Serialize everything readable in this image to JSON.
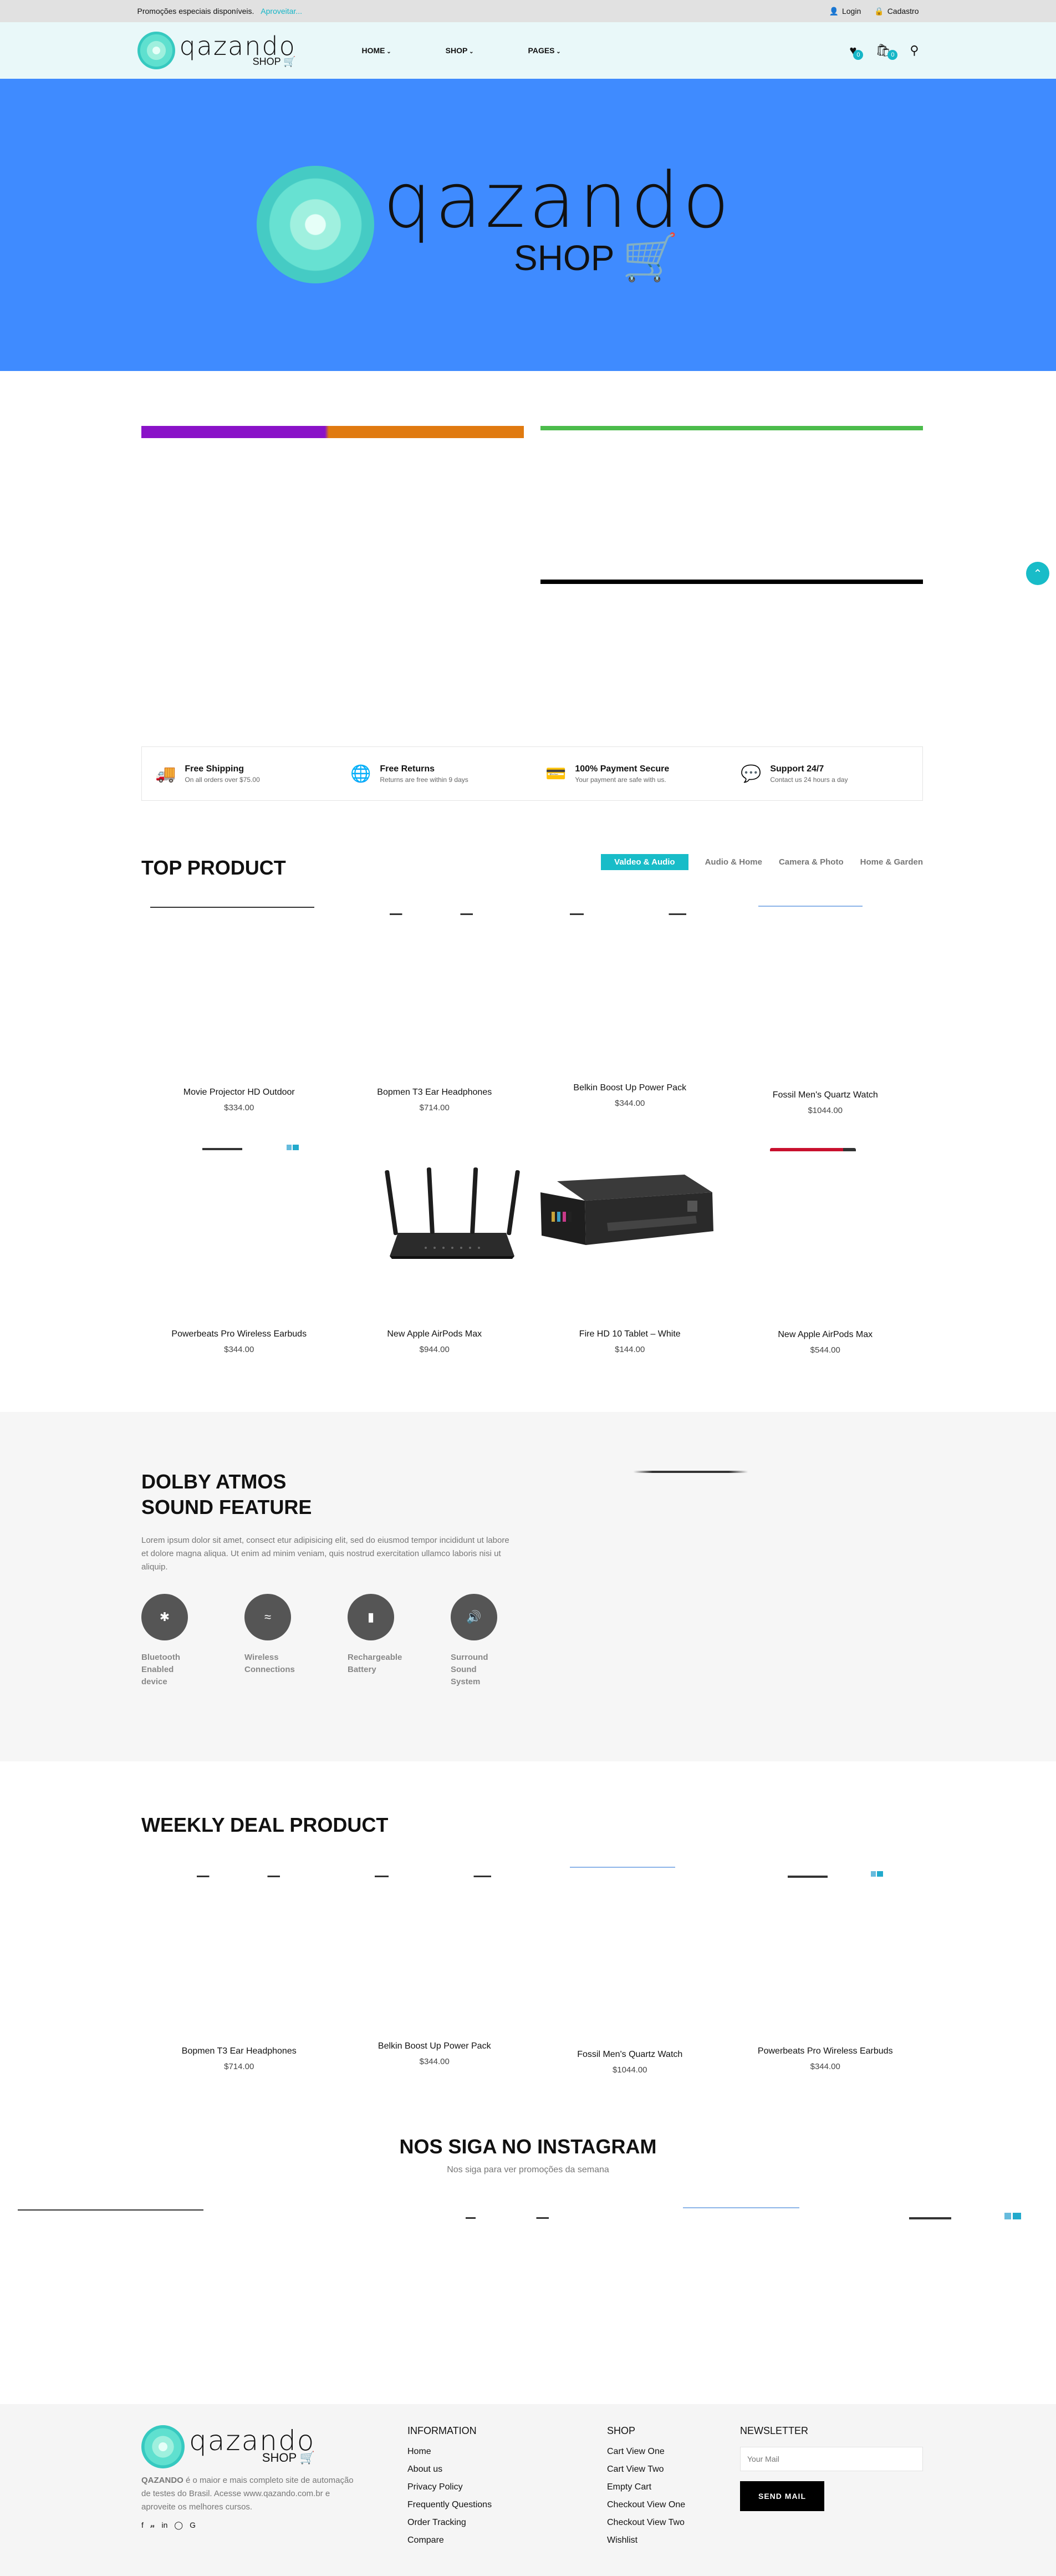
{
  "topbar": {
    "promo": "Promoções especiais disponíveis.",
    "promo_link": "Aproveitar...",
    "login": "Login",
    "register": "Cadastro"
  },
  "brand": {
    "name": "qazando",
    "sub": "SHOP"
  },
  "nav": {
    "home": "HOME",
    "shop": "SHOP",
    "pages": "PAGES"
  },
  "header": {
    "wishlist_count": "0",
    "cart_count": "0"
  },
  "features": [
    {
      "title": "Free Shipping",
      "sub": "On all orders over $75.00",
      "icon": "truck-icon"
    },
    {
      "title": "Free Returns",
      "sub": "Returns are free within 9 days",
      "icon": "globe-icon"
    },
    {
      "title": "100% Payment Secure",
      "sub": "Your payment are safe with us.",
      "icon": "payment-icon"
    },
    {
      "title": "Support 24/7",
      "sub": "Contact us 24 hours a day",
      "icon": "support-icon"
    }
  ],
  "top_product": {
    "title": "TOP PRODUCT",
    "tabs": [
      "Valdeo & Audio",
      "Audio & Home",
      "Camera & Photo",
      "Home & Garden"
    ],
    "items": [
      {
        "name": "Movie Projector HD Outdoor",
        "price": "$334.00"
      },
      {
        "name": "Bopmen T3 Ear Headphones",
        "price": "$714.00"
      },
      {
        "name": "Belkin Boost Up Power Pack",
        "price": "$344.00"
      },
      {
        "name": "Fossil Men's Quartz Watch",
        "price": "$1044.00"
      },
      {
        "name": "Powerbeats Pro Wireless Earbuds",
        "price": "$344.00"
      },
      {
        "name": "New Apple AirPods Max",
        "price": "$944.00"
      },
      {
        "name": "Fire HD 10 Tablet – White",
        "price": "$144.00"
      },
      {
        "name": "New Apple AirPods Max",
        "price": "$544.00"
      }
    ]
  },
  "dolby": {
    "title_line1": "DOLBY ATMOS",
    "title_line2": "SOUND FEATURE",
    "text": "Lorem ipsum dolor sit amet, consect etur adipisicing elit, sed do eiusmod tempor incididunt ut labore et dolore magna aliqua. Ut enim ad minim veniam, quis nostrud exercitation ullamco laboris nisi ut aliquip.",
    "items": [
      {
        "line1": "Bluetooth",
        "line2": "Enabled device",
        "icon": "bluetooth-icon"
      },
      {
        "line1": "Wireless",
        "line2": "Connections",
        "icon": "wifi-icon"
      },
      {
        "line1": "Rechargeable",
        "line2": "Battery",
        "icon": "battery-icon"
      },
      {
        "line1": "Surround Sound",
        "line2": "System",
        "icon": "speaker-icon"
      }
    ]
  },
  "weekly": {
    "title": "WEEKLY DEAL PRODUCT",
    "items": [
      {
        "name": "Bopmen T3 Ear Headphones",
        "price": "$714.00"
      },
      {
        "name": "Belkin Boost Up Power Pack",
        "price": "$344.00"
      },
      {
        "name": "Fossil Men's Quartz Watch",
        "price": "$1044.00"
      },
      {
        "name": "Powerbeats Pro Wireless Earbuds",
        "price": "$344.00"
      }
    ]
  },
  "instagram": {
    "title": "NOS SIGA NO INSTAGRAM",
    "sub": "Nos siga para ver promoções da semana"
  },
  "footer": {
    "about_brand": "QAZANDO",
    "about_text": "é o maior e mais completo site de automação de testes do Brasil. Acesse www.qazando.com.br e aproveite os melhores cursos.",
    "info_title": "INFORMATION",
    "info_links": [
      "Home",
      "About us",
      "Privacy Policy",
      "Frequently Questions",
      "Order Tracking",
      "Compare"
    ],
    "shop_title": "SHOP",
    "shop_links": [
      "Cart View One",
      "Cart View Two",
      "Empty Cart",
      "Checkout View One",
      "Checkout View Two",
      "Wishlist"
    ],
    "newsletter_title": "NEWSLETTER",
    "newsletter_placeholder": "Your Mail",
    "newsletter_button": "SEND MAIL"
  },
  "colors": {
    "accent": "#18bcc8",
    "hero": "#3f8bff"
  }
}
